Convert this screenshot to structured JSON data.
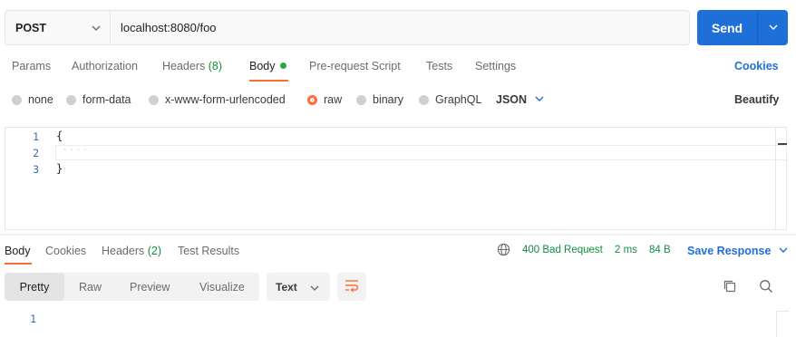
{
  "request": {
    "method": "POST",
    "url": "localhost:8080/foo",
    "send_label": "Send"
  },
  "request_tabs": {
    "params": "Params",
    "authorization": "Authorization",
    "headers": "Headers",
    "headers_count": "(8)",
    "body": "Body",
    "prerequest": "Pre-request Script",
    "tests": "Tests",
    "settings": "Settings",
    "cookies": "Cookies"
  },
  "body_types": {
    "none": "none",
    "form_data": "form-data",
    "urlencoded": "x-www-form-urlencoded",
    "raw": "raw",
    "binary": "binary",
    "graphql": "GraphQL",
    "selected": "raw",
    "language": "JSON",
    "beautify": "Beautify"
  },
  "editor": {
    "line_numbers": [
      "1",
      "2",
      "3"
    ],
    "lines": [
      "{",
      "····",
      "}"
    ]
  },
  "response_tabs": {
    "body": "Body",
    "cookies": "Cookies",
    "headers": "Headers",
    "headers_count": "(2)",
    "test_results": "Test Results"
  },
  "response_status": {
    "status": "400 Bad Request",
    "time": "2 ms",
    "size": "84 B",
    "save_response": "Save Response"
  },
  "response_view": {
    "modes": [
      "Pretty",
      "Raw",
      "Preview",
      "Visualize"
    ],
    "selected_mode": "Pretty",
    "format": "Text",
    "line_numbers": [
      "1"
    ]
  },
  "colors": {
    "accent": "#ff6c37",
    "primary": "#1f6fd8",
    "success": "#0f8f3d"
  },
  "icons": {
    "globe": "globe-icon",
    "copy": "copy-icon",
    "search": "search-icon",
    "wrap": "wrap-lines-icon"
  }
}
